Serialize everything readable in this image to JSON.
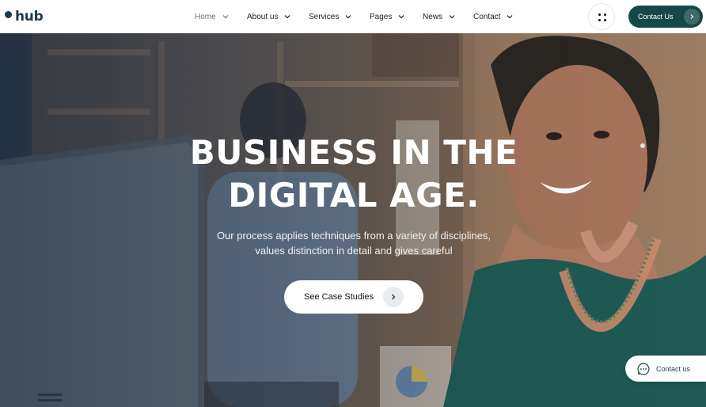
{
  "brand": {
    "name": "hub"
  },
  "nav": {
    "items": [
      {
        "label": "Home",
        "active": true
      },
      {
        "label": "About us"
      },
      {
        "label": "Services"
      },
      {
        "label": "Pages"
      },
      {
        "label": "News"
      },
      {
        "label": "Contact"
      }
    ]
  },
  "header": {
    "contact_label": "Contact Us",
    "menu_icon": "grid-dots-icon"
  },
  "hero": {
    "title_line1": "BUSINESS IN THE",
    "title_line2": "DIGITAL AGE.",
    "subtitle_line1": "Our process applies techniques from a variety of disciplines,",
    "subtitle_line2": "values distinction in detail and gives careful",
    "cta_label": "See Case Studies"
  },
  "chat": {
    "label": "Contact us"
  },
  "colors": {
    "brand": "#1e3a4c",
    "accent": "#174848",
    "white": "#ffffff"
  }
}
